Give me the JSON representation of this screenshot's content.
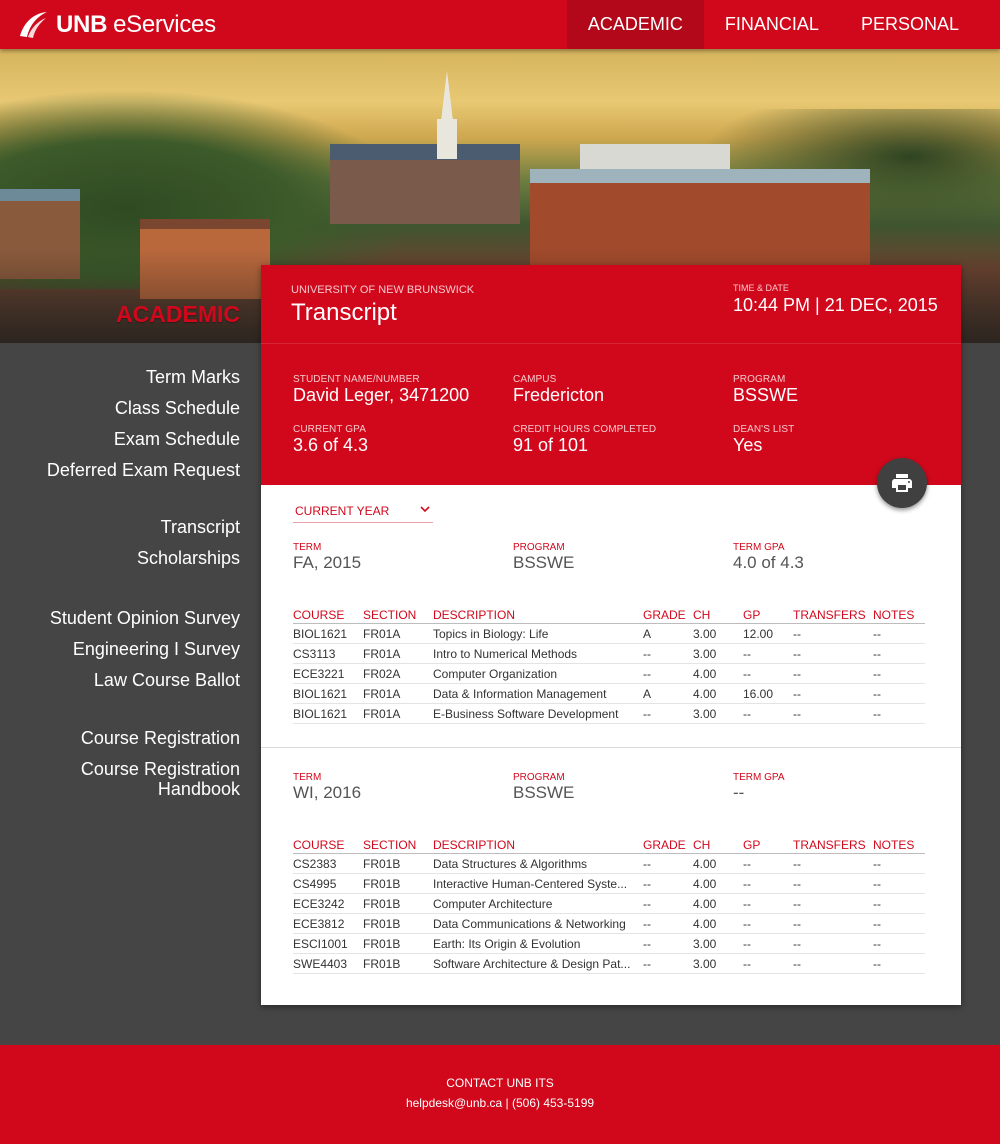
{
  "header": {
    "brand_bold": "UNB",
    "brand_light": "eServices",
    "nav": [
      "ACADEMIC",
      "FINANCIAL",
      "PERSONAL"
    ]
  },
  "sidebar": {
    "title": "ACADEMIC",
    "links": [
      "Term Marks",
      "Class Schedule",
      "Exam Schedule",
      "Deferred Exam Request",
      "Transcript",
      "Scholarships",
      "Student Opinion Survey",
      "Engineering I Survey",
      "Law Course Ballot",
      "Course Registration",
      "Course Registration Handbook"
    ]
  },
  "panel": {
    "university": "UNIVERSITY OF NEW BRUNSWICK",
    "title": "Transcript",
    "time_label": "TIME & DATE",
    "time_value": "10:44 PM | 21 DEC, 2015",
    "info": {
      "student_label": "STUDENT NAME/NUMBER",
      "student_value": "David Leger, 3471200",
      "campus_label": "CAMPUS",
      "campus_value": "Fredericton",
      "program_label": "PROGRAM",
      "program_value": "BSSWE",
      "gpa_label": "CURRENT GPA",
      "gpa_value": "3.6 of 4.3",
      "credit_label": "CREDIT HOURS COMPLETED",
      "credit_value": "91 of 101",
      "dean_label": "DEAN'S LIST",
      "dean_value": "Yes"
    },
    "year_select": "CURRENT YEAR",
    "columns": [
      "COURSE",
      "SECTION",
      "DESCRIPTION",
      "GRADE",
      "CH",
      "GP",
      "TRANSFERS",
      "NOTES"
    ],
    "terms": [
      {
        "term_label": "TERM",
        "term_value": "FA, 2015",
        "program_label": "PROGRAM",
        "program_value": "BSSWE",
        "gpa_label": "TERM GPA",
        "gpa_value": "4.0 of 4.3",
        "rows": [
          [
            "BIOL1621",
            "FR01A",
            "Topics in Biology: Life",
            "A",
            "3.00",
            "12.00",
            "--",
            "--"
          ],
          [
            "CS3113",
            "FR01A",
            "Intro to Numerical Methods",
            "--",
            "3.00",
            "--",
            "--",
            "--"
          ],
          [
            "ECE3221",
            "FR02A",
            "Computer Organization",
            "--",
            "4.00",
            "--",
            "--",
            "--"
          ],
          [
            "BIOL1621",
            "FR01A",
            "Data & Information Management",
            "A",
            "4.00",
            "16.00",
            "--",
            "--"
          ],
          [
            "BIOL1621",
            "FR01A",
            "E-Business Software Development",
            "--",
            "3.00",
            "--",
            "--",
            "--"
          ]
        ]
      },
      {
        "term_label": "TERM",
        "term_value": "WI, 2016",
        "program_label": "PROGRAM",
        "program_value": "BSSWE",
        "gpa_label": "TERM GPA",
        "gpa_value": "--",
        "rows": [
          [
            "CS2383",
            "FR01B",
            "Data Structures & Algorithms",
            "--",
            "4.00",
            "--",
            "--",
            "--"
          ],
          [
            "CS4995",
            "FR01B",
            "Interactive Human-Centered Syste...",
            "--",
            "4.00",
            "--",
            "--",
            "--"
          ],
          [
            "ECE3242",
            "FR01B",
            "Computer Architecture",
            "--",
            "4.00",
            "--",
            "--",
            "--"
          ],
          [
            "ECE3812",
            "FR01B",
            "Data Communications & Networking",
            "--",
            "4.00",
            "--",
            "--",
            "--"
          ],
          [
            "ESCI1001",
            "FR01B",
            "Earth: Its Origin & Evolution",
            "--",
            "3.00",
            "--",
            "--",
            "--"
          ],
          [
            "SWE4403",
            "FR01B",
            "Software Architecture & Design Pat...",
            "--",
            "3.00",
            "--",
            "--",
            "--"
          ]
        ]
      }
    ]
  },
  "footer": {
    "contact": "CONTACT UNB ITS",
    "details": "helpdesk@unb.ca | (506) 453-5199"
  },
  "icons": {
    "logo": "unb-swoosh-logo-icon",
    "print": "printer-icon",
    "chevron": "chevron-down-icon"
  },
  "colors": {
    "brand_red": "#d1081c",
    "sidebar_gray": "#454545"
  }
}
